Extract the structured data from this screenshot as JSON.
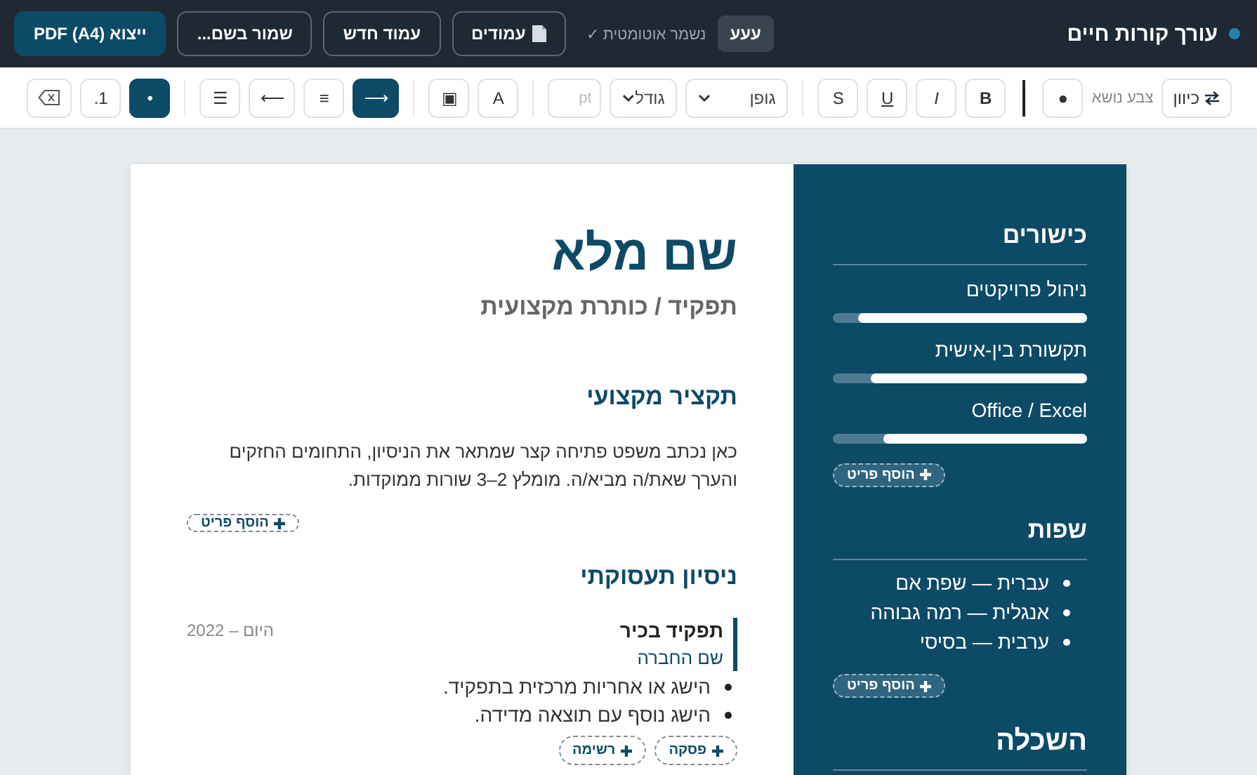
{
  "app": {
    "title": "עורך קורות חיים",
    "badge": "עעע",
    "autosave": "נשמר אוטומטית ✓",
    "buttons": [
      {
        "label": "עמודים",
        "kind": "pages"
      },
      {
        "label": "עמוד חדש",
        "kind": "outline"
      },
      {
        "label": "שמור בשם...",
        "kind": "outline"
      },
      {
        "label": "ייצוא PDF (A4)",
        "kind": "primary"
      }
    ]
  },
  "toolbar": {
    "groups": [
      {
        "items": [
          {
            "kind": "swap-button",
            "label": "כיוון",
            "selected": false
          },
          {
            "kind": "label",
            "label": "צבע נושא"
          },
          {
            "kind": "button",
            "label": "●",
            "selected": false
          }
        ]
      },
      {
        "items": [
          {
            "kind": "button",
            "label": "B",
            "selected": false
          },
          {
            "kind": "button",
            "label": "I",
            "selected": false
          },
          {
            "kind": "button",
            "label": "U",
            "selected": false
          },
          {
            "kind": "button",
            "label": "S",
            "selected": false
          }
        ]
      },
      {
        "items": [
          {
            "kind": "select",
            "label": "גופן"
          },
          {
            "kind": "select",
            "label": "גודל"
          },
          {
            "kind": "input",
            "placeholder": "pt"
          }
        ]
      },
      {
        "items": [
          {
            "kind": "button",
            "label": "A",
            "selected": false
          },
          {
            "kind": "button",
            "label": "▣",
            "selected": false
          }
        ]
      },
      {
        "items": [
          {
            "kind": "button",
            "label": "⟶",
            "selected": true
          },
          {
            "kind": "button",
            "label": "≡",
            "selected": false
          },
          {
            "kind": "button",
            "label": "⟵",
            "selected": false
          },
          {
            "kind": "button",
            "label": "☰",
            "selected": false
          }
        ]
      },
      {
        "items": [
          {
            "kind": "button",
            "label": "•",
            "selected": true
          },
          {
            "kind": "button",
            "label": "1.",
            "selected": false
          },
          {
            "kind": "clear-button",
            "selected": false
          }
        ]
      }
    ]
  },
  "resume": {
    "name": "שם מלא",
    "role": "תפקיד / כותרת מקצועית",
    "summary": {
      "heading": "תקציר מקצועי",
      "text": "כאן נכתב משפט פתיחה קצר שמתאר את הניסיון, התחומים החזקים והערך שאת/ה מביא/ה. מומלץ 2–3 שורות ממוקדות.",
      "add": "הוסף פריט"
    },
    "experience": {
      "heading": "ניסיון תעסוקתי",
      "jobs": [
        {
          "title": "תפקיד בכיר",
          "company": "שם החברה",
          "dates": "2022 – היום",
          "bullets": [
            "הישג או אחריות מרכזית בתפקיד.",
            "הישג נוסף עם תוצאה מדידה."
          ],
          "actions": [
            "פסקה",
            "רשימה"
          ]
        }
      ]
    },
    "sidebar": {
      "skills": {
        "heading": "כישורים",
        "items": [
          {
            "name": "ניהול פרויקטים",
            "level": 0.9
          },
          {
            "name": "תקשורת בין-אישית",
            "level": 0.85
          },
          {
            "name": "Office / Excel",
            "level": 0.8
          }
        ],
        "add": "הוסף פריט"
      },
      "languages": {
        "heading": "שפות",
        "items": [
          "עברית — שפת אם",
          "אנגלית — רמה גבוהה",
          "ערבית — בסיסי"
        ],
        "add": "הוסף פריט"
      },
      "education": {
        "heading": "השכלה"
      }
    }
  }
}
